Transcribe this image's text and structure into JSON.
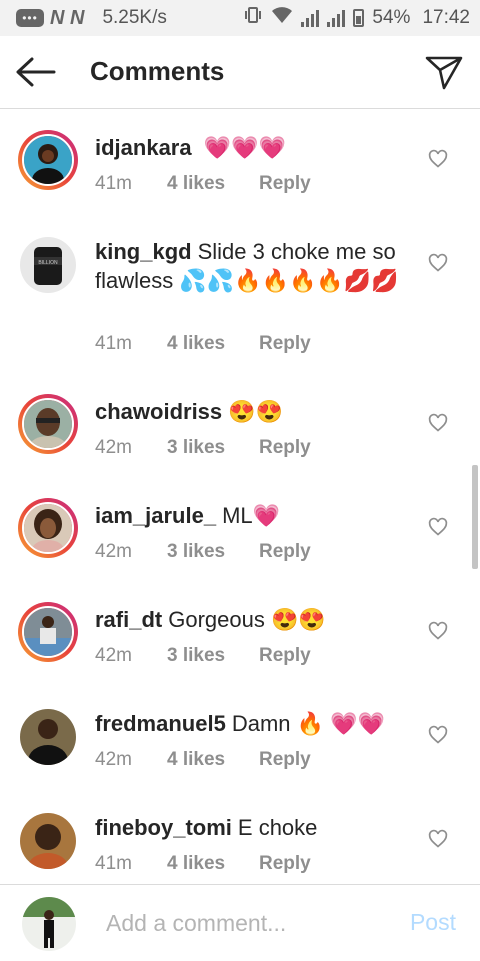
{
  "status_bar": {
    "carrier_icons": "N N",
    "net_speed": "5.25K/s",
    "battery": "54%",
    "time": "17:42"
  },
  "header": {
    "title": "Comments",
    "back_icon": "arrow-left-icon",
    "send_icon": "paper-plane-icon"
  },
  "comments": [
    {
      "username": "idjankara",
      "text": "",
      "emoji": "💗💗💗",
      "time": "41m",
      "likes": "4 likes",
      "reply": "Reply",
      "ring": true
    },
    {
      "username": "king_kgd",
      "text": "Slide 3 choke me so flawless",
      "emoji": "💦💦🔥🔥🔥🔥💋💋",
      "time": "41m",
      "likes": "4 likes",
      "reply": "Reply",
      "ring": false
    },
    {
      "username": "chawoidriss",
      "text": "",
      "emoji": "😍😍",
      "time": "42m",
      "likes": "3 likes",
      "reply": "Reply",
      "ring": true
    },
    {
      "username": "iam_jarule_",
      "text": "ML",
      "emoji": "💗",
      "time": "42m",
      "likes": "3 likes",
      "reply": "Reply",
      "ring": true
    },
    {
      "username": "rafi_dt",
      "text": "Gorgeous",
      "emoji": "😍😍",
      "time": "42m",
      "likes": "3 likes",
      "reply": "Reply",
      "ring": true
    },
    {
      "username": "fredmanuel5",
      "text": "Damn",
      "emoji": "🔥 💗💗",
      "time": "42m",
      "likes": "4 likes",
      "reply": "Reply",
      "ring": false
    },
    {
      "username": "fineboy_tomi",
      "text": "E choke",
      "emoji": "",
      "time": "41m",
      "likes": "4 likes",
      "reply": "Reply",
      "ring": false
    }
  ],
  "composer": {
    "placeholder": "Add a comment...",
    "post_label": "Post"
  },
  "colors": {
    "accent_post": "#b3dbff",
    "meta_gray": "#8e8e8e",
    "story_ring": "#e8443a"
  }
}
